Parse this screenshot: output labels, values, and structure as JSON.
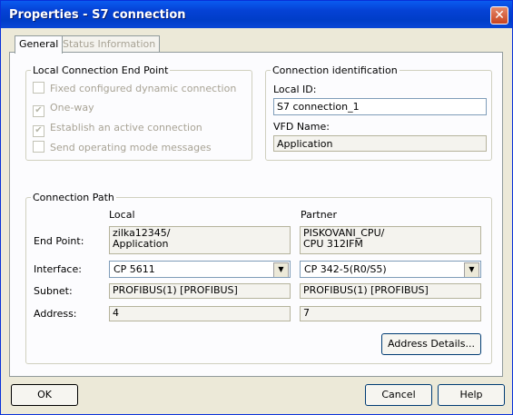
{
  "window": {
    "title": "Properties - S7 connection",
    "close_glyph": "✕"
  },
  "tabs": [
    "General",
    "Status Information"
  ],
  "local_endpoint": {
    "title": "Local Connection End Point",
    "checkboxes": [
      {
        "label": "Fixed configured dynamic connection",
        "checked": false
      },
      {
        "label": "One-way",
        "checked": true
      },
      {
        "label": "Establish an active connection",
        "checked": true
      },
      {
        "label": "Send operating mode messages",
        "checked": false
      }
    ]
  },
  "connection_id": {
    "title": "Connection identification",
    "local_id_label": "Local ID:",
    "local_id_value": "S7 connection_1",
    "vfd_label": "VFD Name:",
    "vfd_value": "Application"
  },
  "connection_path": {
    "title": "Connection Path",
    "col_local": "Local",
    "col_partner": "Partner",
    "rows": {
      "end_point": {
        "label": "End Point:",
        "local_1": "zilka12345/",
        "local_2": "Application",
        "partner_1": "PISKOVANI_CPU/",
        "partner_2": "CPU 312IFM"
      },
      "interface": {
        "label": "Interface:",
        "local": "CP 5611",
        "partner": "CP 342-5(R0/S5)"
      },
      "subnet": {
        "label": "Subnet:",
        "local": "PROFIBUS(1) [PROFIBUS]",
        "partner": "PROFIBUS(1) [PROFIBUS]"
      },
      "address": {
        "label": "Address:",
        "local": "4",
        "partner": "7"
      }
    },
    "address_details_button": "Address Details..."
  },
  "buttons": {
    "ok": "OK",
    "cancel": "Cancel",
    "help": "Help"
  }
}
